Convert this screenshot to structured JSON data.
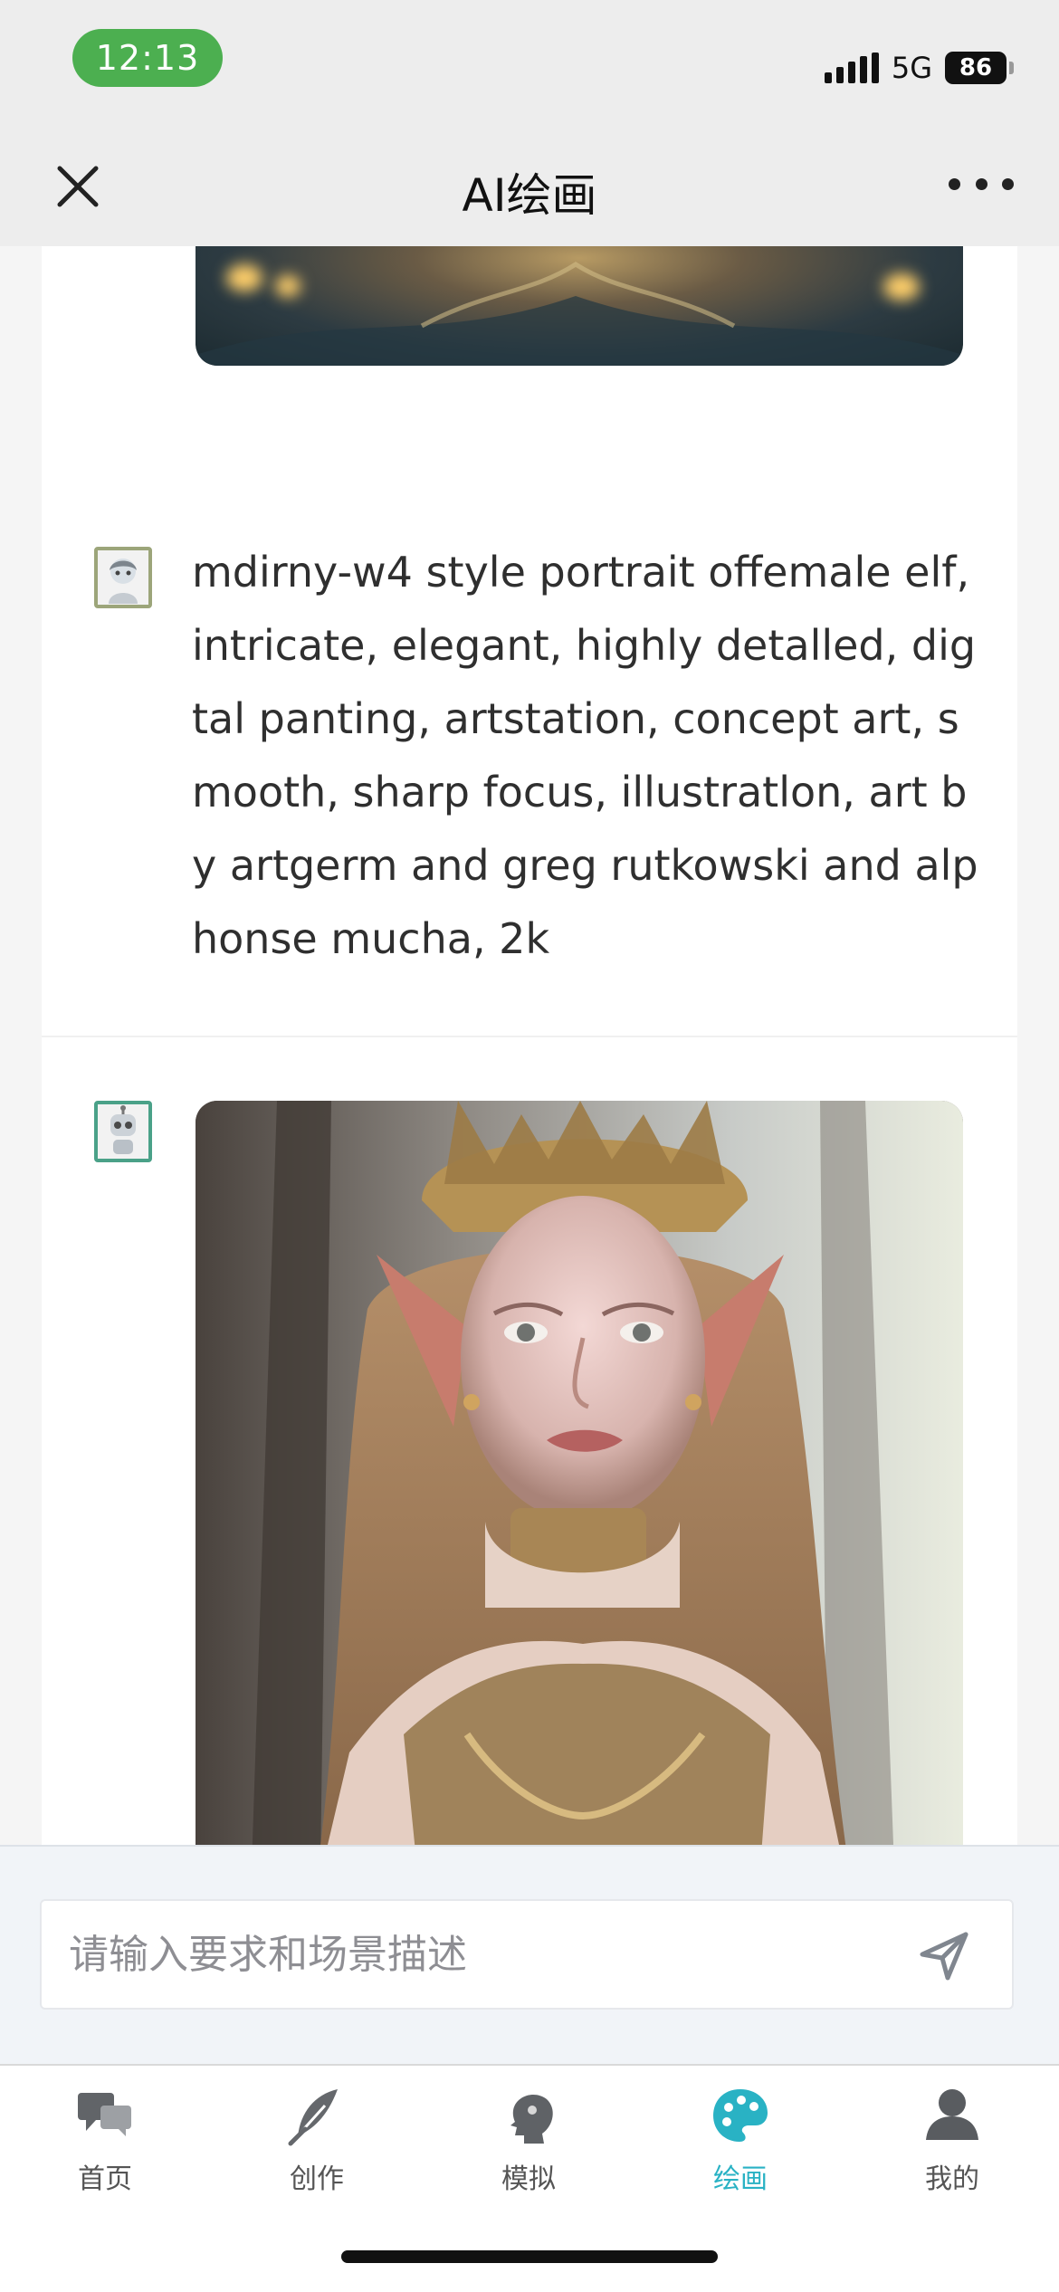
{
  "status": {
    "time": "12:13",
    "network": "5G",
    "battery": "86",
    "icons": [
      "signal-icon",
      "battery-icon"
    ]
  },
  "nav": {
    "title": "AI绘画",
    "icons": [
      "close-icon",
      "more-icon"
    ]
  },
  "chat": {
    "prompt": "mdirny-w4 style portrait offemale elf, intricate, elegant, highly detalled, digtal panting, artstation, concept art, smooth, sharp focus, illustratlon, art by artgerm and greg rutkowski and alphonse mucha, 2k",
    "user_avatar": "user-avatar",
    "bot_avatar": "robot-avatar",
    "images": [
      "generated-fantasy-image",
      "generated-elf-portrait"
    ]
  },
  "input": {
    "placeholder": "请输入要求和场景描述",
    "value": "",
    "send_icon": "send-icon"
  },
  "tabs": [
    {
      "label": "首页",
      "icon": "chat-bubbles-icon",
      "active": false
    },
    {
      "label": "创作",
      "icon": "feather-icon",
      "active": false
    },
    {
      "label": "模拟",
      "icon": "head-icon",
      "active": false
    },
    {
      "label": "绘画",
      "icon": "palette-icon",
      "active": true
    },
    {
      "label": "我的",
      "icon": "person-icon",
      "active": false
    }
  ],
  "colors": {
    "time_pill": "#4caf50",
    "active_tab": "#29b2c4",
    "status_bar": "#ededed",
    "page_background": "#f5f5f5"
  }
}
